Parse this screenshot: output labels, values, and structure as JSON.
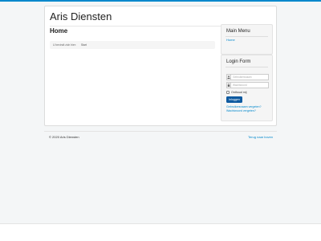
{
  "site": {
    "title": "Aris Diensten"
  },
  "main": {
    "page_title": "Home",
    "breadcrumb": {
      "prefix": "U bevindt zich hier:",
      "items": [
        "Start"
      ]
    }
  },
  "sidebar": {
    "main_menu": {
      "title": "Main Menu",
      "items": [
        {
          "label": "Home"
        }
      ]
    },
    "login_form": {
      "title": "Login Form",
      "username_placeholder": "Gebruikersnaam",
      "password_placeholder": "Wachtwoord",
      "remember_label": "Onthoud mij",
      "login_button": "Inloggen",
      "forgot_username": "Gebruikersnaam vergeten?",
      "forgot_password": "Wachtwoord vergeten?"
    }
  },
  "footer": {
    "copyright": "© 2020 Aris Diensten",
    "back_to_top": "Terug naar boven"
  },
  "colors": {
    "accent": "#0088cc",
    "button": "#0e5aa0"
  },
  "icons": {
    "username": "user-icon",
    "password": "lock-icon"
  }
}
